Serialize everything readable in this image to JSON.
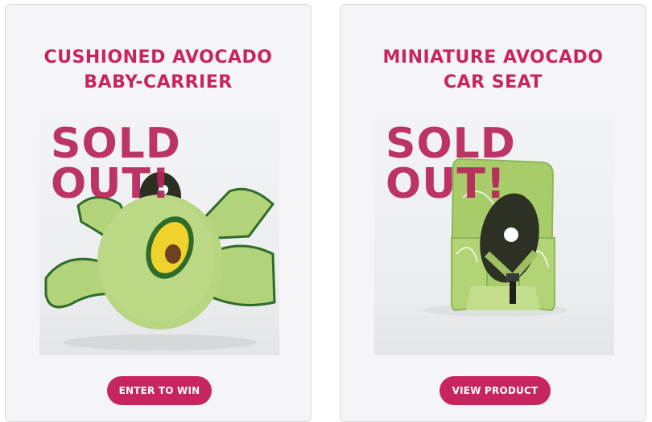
{
  "products": [
    {
      "title_line1": "CUSHIONED AVOCADO",
      "title_line2": "BABY-CARRIER",
      "badge_line1": "SOLD",
      "badge_line2": "OUT!",
      "button_label": "ENTER TO WIN"
    },
    {
      "title_line1": "MINIATURE AVOCADO",
      "title_line2": "CAR SEAT",
      "badge_line1": "SOLD",
      "badge_line2": "OUT!",
      "button_label": "VIEW PRODUCT"
    }
  ],
  "colors": {
    "brand": "#c8255e",
    "card_bg": "#f5f5f7",
    "avocado_green": "#a9cc6b",
    "avocado_dark": "#2f3a23"
  }
}
